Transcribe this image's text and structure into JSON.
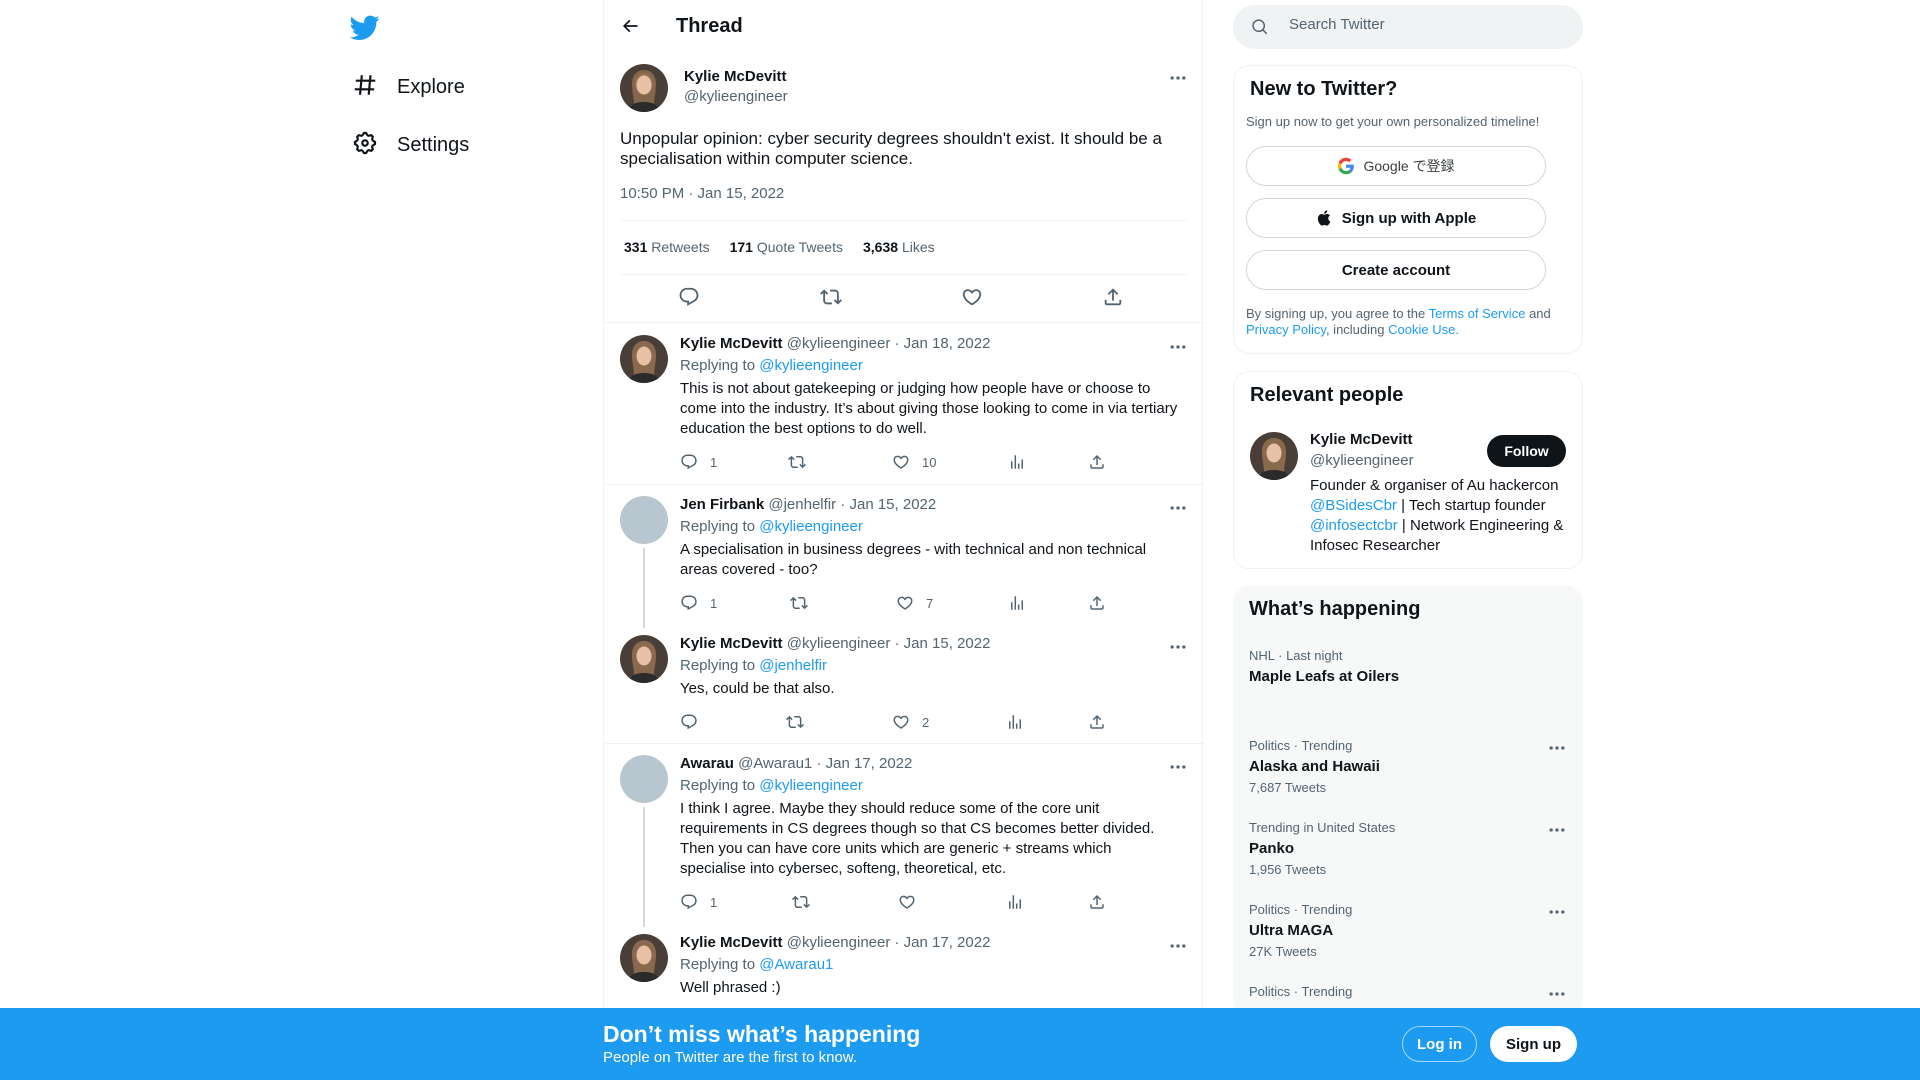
{
  "nav": {
    "logo": "twitter-bird",
    "items": [
      {
        "label": "Explore",
        "icon": "hashtag-icon"
      },
      {
        "label": "Settings",
        "icon": "gear-icon"
      }
    ]
  },
  "header": {
    "title": "Thread"
  },
  "main_tweet": {
    "name": "Kylie McDevitt",
    "handle": "@kylieengineer",
    "text": "Unpopular opinion: cyber security degrees shouldn't exist. It should be a specialisation within computer science.",
    "timestamp": "10:50 PM · Jan 15, 2022",
    "stats": {
      "retweets_count": "331",
      "retweets_label": "Retweets",
      "quotes_count": "171",
      "quotes_label": "Quote Tweets",
      "likes_count": "3,638",
      "likes_label": "Likes"
    }
  },
  "replies": [
    {
      "name": "Kylie McDevitt",
      "handle": "@kylieengineer",
      "date": "· Jan 18, 2022",
      "replying_label": "Replying to",
      "replying_to": "@kylieengineer",
      "text": "This is not about gatekeeping or judging how people have or choose to come into the industry. It’s about giving those looking to come in via tertiary education the best options to do well.",
      "replies": "1",
      "likes": "10"
    },
    {
      "name": "Jen Firbank",
      "handle": "@jenhelfir",
      "date": "· Jan 15, 2022",
      "replying_label": "Replying to",
      "replying_to": "@kylieengineer",
      "text": "A specialisation in business degrees - with technical and non technical areas covered - too?",
      "replies": "1",
      "likes": "7"
    },
    {
      "name": "Kylie McDevitt",
      "handle": "@kylieengineer",
      "date": "· Jan 15, 2022",
      "replying_label": "Replying to",
      "replying_to": "@jenhelfir",
      "text": "Yes, could be that also.",
      "replies": "",
      "likes": "2"
    },
    {
      "name": "Awarau",
      "handle": "@Awarau1",
      "date": "· Jan 17, 2022",
      "replying_label": "Replying to",
      "replying_to": "@kylieengineer",
      "text": "I think I agree. Maybe they should reduce some of the core unit requirements in CS degrees though so that CS becomes better divided. Then you can have core units which are generic + streams which specialise into cybersec, softeng, theoretical, etc.",
      "replies": "1",
      "likes": ""
    },
    {
      "name": "Kylie McDevitt",
      "handle": "@kylieengineer",
      "date": "· Jan 17, 2022",
      "replying_label": "Replying to",
      "replying_to": "@Awarau1",
      "text": "Well phrased :)"
    }
  ],
  "search": {
    "placeholder": "Search Twitter"
  },
  "new_to_twitter": {
    "title": "New to Twitter?",
    "subtitle": "Sign up now to get your own personalized timeline!",
    "google_label": "Google で登録",
    "apple_label": "Sign up with Apple",
    "create_label": "Create account",
    "legal_prefix": "By signing up, you agree to the",
    "terms": "Terms of Service",
    "and": "and",
    "privacy": "Privacy Policy",
    "including": ", including",
    "cookie": "Cookie Use."
  },
  "relevant_people": {
    "title": "Relevant people",
    "name": "Kylie McDevitt",
    "handle": "@kylieengineer",
    "follow_label": "Follow",
    "bio_1": "Founder & organiser of Au hackercon",
    "bio_link1": "@BSidesCbr",
    "bio_2": " | Tech startup founder",
    "bio_link2": "@infosectcbr",
    "bio_3": " | Network Engineering & Infosec Researcher"
  },
  "happening": {
    "title": "What’s happening",
    "trends": [
      {
        "meta": "NHL · Last night",
        "name": "Maple Leafs at Oilers",
        "count": ""
      },
      {
        "meta": "Politics · Trending",
        "name": "Alaska and Hawaii",
        "count": "7,687 Tweets"
      },
      {
        "meta": "Trending in United States",
        "name": "Panko",
        "count": "1,956 Tweets"
      },
      {
        "meta": "Politics · Trending",
        "name": "Ultra MAGA",
        "count": "27K Tweets"
      },
      {
        "meta": "Politics · Trending",
        "name": "",
        "count": ""
      }
    ]
  },
  "banner": {
    "title": "Don’t miss what’s happening",
    "subtitle": "People on Twitter are the first to know.",
    "login_label": "Log in",
    "signup_label": "Sign up"
  },
  "colors": {
    "accent": "#1d9bf0",
    "text": "#0f1419",
    "muted": "#536471",
    "border": "#eff3f4"
  }
}
